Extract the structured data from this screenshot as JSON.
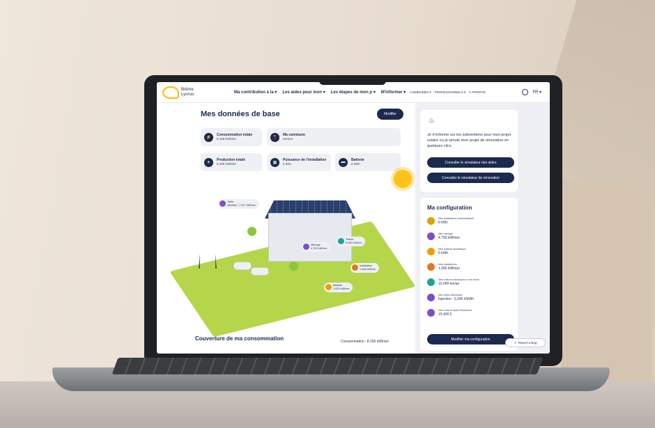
{
  "navbar": {
    "logo_text": "Brême Lyoruo",
    "items": [
      "Ma contribution à la ▾",
      "Les aides pour mon ▾",
      "Les étapes de mon p ▾",
      "M'informer ▾"
    ],
    "small_items": [
      "COMMUNES ▾",
      "PROFESSIONNELS ▾",
      "À PROPOS"
    ],
    "lang": "FR ▾"
  },
  "main": {
    "title": "Mes données de base",
    "modify_label": "Modifier",
    "cards": [
      {
        "label": "Consommation totale",
        "value": "8.156 kWh/an",
        "icon": "⚡"
      },
      {
        "label": "Ma commune",
        "value": "Senem",
        "icon": "📍"
      },
      {
        "label": "Production totale",
        "value": "6.286 kWh/an",
        "icon": "☀"
      },
      {
        "label": "Puissance de l'installation",
        "value": "6 kWc",
        "icon": "▦"
      },
      {
        "label": "Batterie",
        "value": "6 kWh",
        "icon": "▬"
      }
    ],
    "bubbles": [
      {
        "title": "Tarifs",
        "value": "Injection : 2.417 kWh/an"
      },
      {
        "title": "Ménage",
        "value": "4.750 kWh/an"
      },
      {
        "title": "Installation",
        "value": "1.066 kWh/an"
      },
      {
        "title": "Toiture",
        "value": "6.286 kWh/an"
      },
      {
        "title": "Batterie",
        "value": "1.620 kWh/an"
      }
    ],
    "section_title": "Couverture de ma consommation",
    "consumption_label": "Consommation : 8.156 kWh/an"
  },
  "side": {
    "promo_text": "Je m'informe sur les subventions pour mon projet solaire ou je simule mon projet de rénovation en quelques clics.",
    "btn_aides": "Consulter le simulateur des aides",
    "btn_renovation": "Consulter le simulateur de rénovation",
    "config_title": "Ma configuration",
    "config_items": [
      {
        "label": "Mes installations photovoltaïque",
        "value": "6 kWc",
        "color": "#d9a400"
      },
      {
        "label": "Mes ménage",
        "value": "4.750 kWh/an",
        "color": "#7a4fc7"
      },
      {
        "label": "Mes batterie domestique",
        "value": "6 kWh",
        "color": "#f0a000"
      },
      {
        "label": "Mes installations",
        "value": "1.066 kWh/an",
        "color": "#e07a22"
      },
      {
        "label": "Mes voitures électriques et ma borne",
        "value": "10.000 km/an",
        "color": "#1aa3a3"
      },
      {
        "label": "Mes tarifs d'électricité",
        "value": "Injection : 0,035 €/kWh",
        "color": "#7a4fc7"
      },
      {
        "label": "Mes coûts et aides financières",
        "value": "15.426 €",
        "color": "#7a4fc7"
      }
    ],
    "btn_config": "Modifier ma configuration",
    "bug_label": "Report a Bug"
  }
}
